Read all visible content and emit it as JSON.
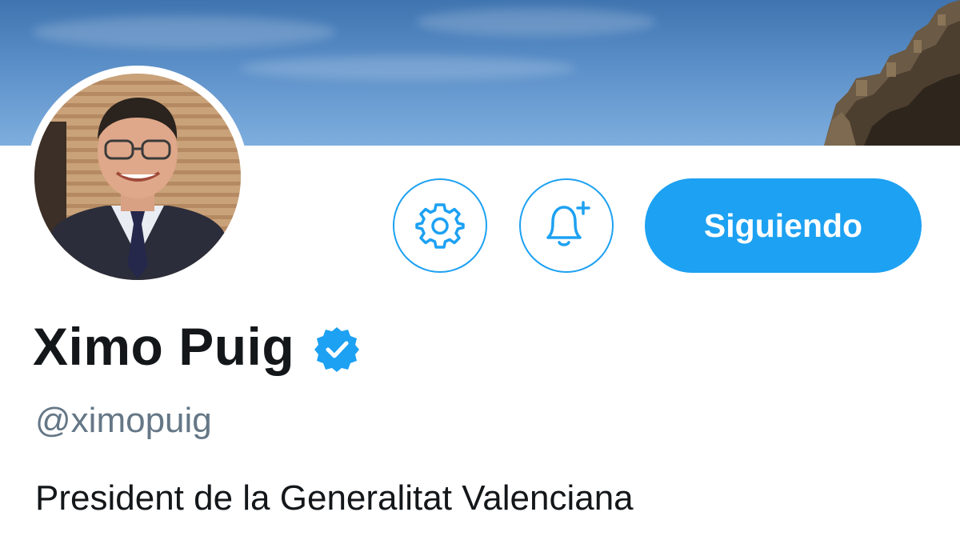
{
  "profile": {
    "display_name": "Ximo Puig",
    "handle": "@ximopuig",
    "bio": "President de la Generalitat Valenciana",
    "verified": true,
    "verified_icon": "verified-badge-icon"
  },
  "actions": {
    "settings_icon": "gear-icon",
    "notifications_icon": "bell-plus-icon",
    "follow_label": "Siguiendo"
  },
  "colors": {
    "accent": "#1da1f2",
    "text_primary": "#14171a",
    "text_secondary": "#657786",
    "background": "#ffffff"
  }
}
